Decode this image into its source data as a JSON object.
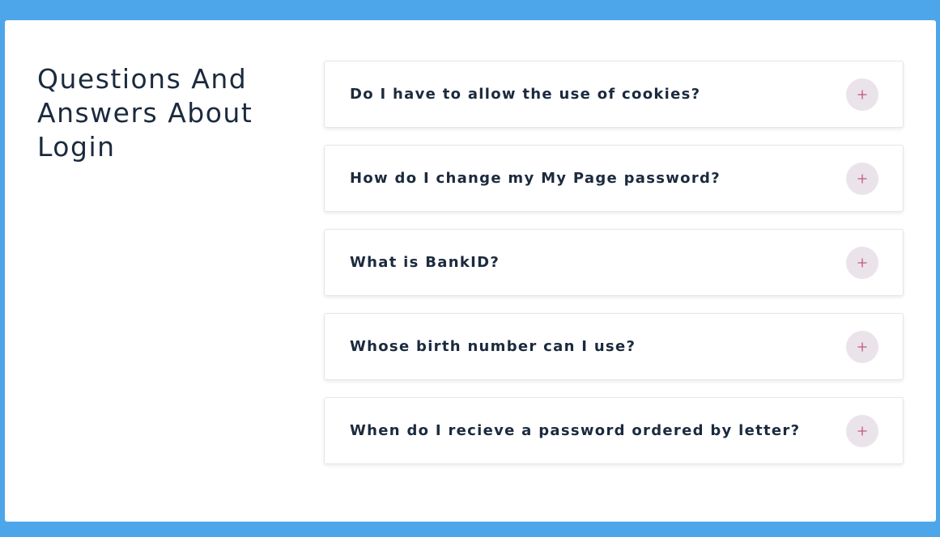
{
  "page": {
    "title": "Questions And Answers About Login"
  },
  "faq": {
    "items": [
      {
        "question": "Do I have to allow the use of cookies?",
        "icon": "plus-icon"
      },
      {
        "question": "How do I change my My Page password?",
        "icon": "plus-icon"
      },
      {
        "question": "What is BankID?",
        "icon": "plus-icon"
      },
      {
        "question": "Whose birth number can I use?",
        "icon": "plus-icon"
      },
      {
        "question": "When do I recieve a password ordered by letter?",
        "icon": "plus-icon"
      }
    ]
  },
  "colors": {
    "frame_background": "#4da6ea",
    "card_background": "#ffffff",
    "text": "#1b2a3e",
    "plus_button_background": "#ebe3ea",
    "plus_icon": "#c0577f"
  }
}
